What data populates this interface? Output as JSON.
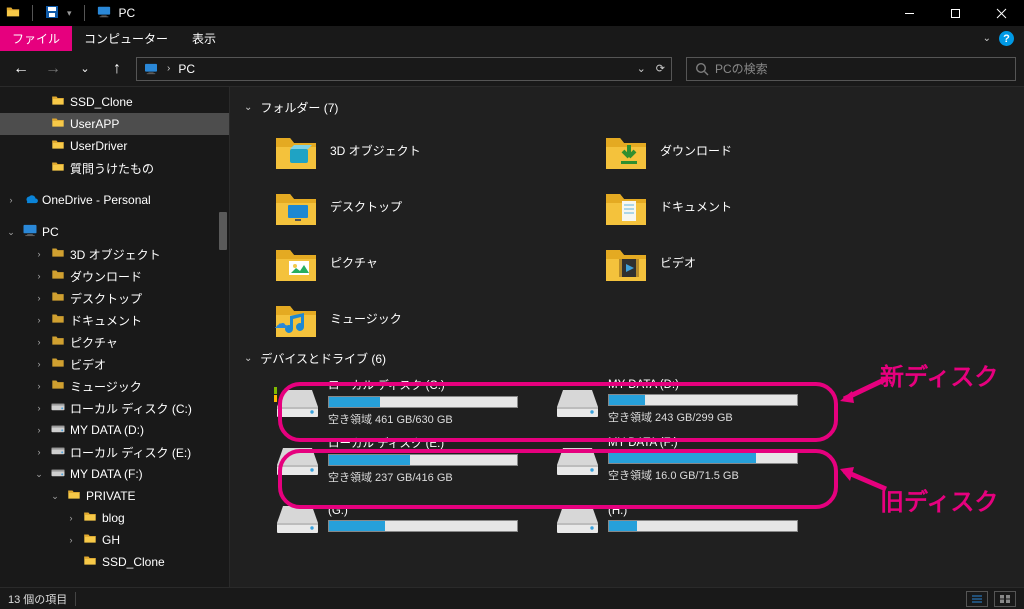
{
  "titlebar": {
    "title": "PC",
    "dropdown": "▾"
  },
  "ribbon": {
    "file": "ファイル",
    "tabs": [
      "コンピューター",
      "表示"
    ]
  },
  "navbar": {
    "breadcrumb": [
      "PC"
    ],
    "search_placeholder": "PCの検索"
  },
  "sidebar": {
    "items": [
      {
        "label": "SSD_Clone",
        "icon": "folder",
        "indent": 1,
        "tw": ""
      },
      {
        "label": "UserAPP",
        "icon": "folder",
        "indent": 1,
        "tw": "",
        "selected": true
      },
      {
        "label": "UserDriver",
        "icon": "folder",
        "indent": 1,
        "tw": ""
      },
      {
        "label": "質問うけたもの",
        "icon": "folder",
        "indent": 1,
        "tw": ""
      },
      {
        "gap": true
      },
      {
        "label": "OneDrive - Personal",
        "icon": "onedrive",
        "indent": 0,
        "tw": "›"
      },
      {
        "gap": true
      },
      {
        "label": "PC",
        "icon": "pc",
        "indent": 0,
        "tw": "⌄",
        "selected_pc": true
      },
      {
        "label": "3D オブジェクト",
        "icon": "sys",
        "indent": 1,
        "tw": "›"
      },
      {
        "label": "ダウンロード",
        "icon": "sys",
        "indent": 1,
        "tw": "›"
      },
      {
        "label": "デスクトップ",
        "icon": "sys",
        "indent": 1,
        "tw": "›"
      },
      {
        "label": "ドキュメント",
        "icon": "sys",
        "indent": 1,
        "tw": "›"
      },
      {
        "label": "ピクチャ",
        "icon": "sys",
        "indent": 1,
        "tw": "›"
      },
      {
        "label": "ビデオ",
        "icon": "sys",
        "indent": 1,
        "tw": "›"
      },
      {
        "label": "ミュージック",
        "icon": "sys",
        "indent": 1,
        "tw": "›"
      },
      {
        "label": "ローカル ディスク (C:)",
        "icon": "drive",
        "indent": 1,
        "tw": "›"
      },
      {
        "label": "MY DATA (D:)",
        "icon": "drive",
        "indent": 1,
        "tw": "›"
      },
      {
        "label": "ローカル ディスク (E:)",
        "icon": "drive",
        "indent": 1,
        "tw": "›"
      },
      {
        "label": "MY DATA (F:)",
        "icon": "drive",
        "indent": 1,
        "tw": "⌄"
      },
      {
        "label": "PRIVATE",
        "icon": "folder",
        "indent": 2,
        "tw": "⌄"
      },
      {
        "label": "blog",
        "icon": "folder",
        "indent": 3,
        "tw": "›"
      },
      {
        "label": "GH",
        "icon": "folder",
        "indent": 3,
        "tw": "›"
      },
      {
        "label": "SSD_Clone",
        "icon": "folder",
        "indent": 3,
        "tw": ""
      }
    ]
  },
  "content": {
    "folders_header": "フォルダー (7)",
    "folders": [
      {
        "label": "3D オブジェクト",
        "kind": "3d"
      },
      {
        "label": "ダウンロード",
        "kind": "download"
      },
      {
        "label": "デスクトップ",
        "kind": "desktop"
      },
      {
        "label": "ドキュメント",
        "kind": "document"
      },
      {
        "label": "ピクチャ",
        "kind": "pictures"
      },
      {
        "label": "ビデオ",
        "kind": "videos"
      },
      {
        "label": "ミュージック",
        "kind": "music"
      }
    ],
    "drives_header": "デバイスとドライブ (6)",
    "drives": [
      {
        "name": "ローカル ディスク (C:)",
        "sub": "空き領域 461 GB/630 GB",
        "fill_pct": 27,
        "os": true
      },
      {
        "name": "MY DATA (D:)",
        "sub": "空き領域 243 GB/299 GB",
        "fill_pct": 19
      },
      {
        "name": "ローカル ディスク (E:)",
        "sub": "空き領域 237 GB/416 GB",
        "fill_pct": 43
      },
      {
        "name": "MY DATA (F:)",
        "sub": "空き領域 16.0 GB/71.5 GB",
        "fill_pct": 78
      },
      {
        "name": "(G:)",
        "sub": "",
        "fill_pct": 30
      },
      {
        "name": "(H:)",
        "sub": "",
        "fill_pct": 15
      }
    ]
  },
  "annotations": {
    "new_disk": "新ディスク",
    "old_disk": "旧ディスク"
  },
  "status": {
    "text": "13 個の項目"
  }
}
